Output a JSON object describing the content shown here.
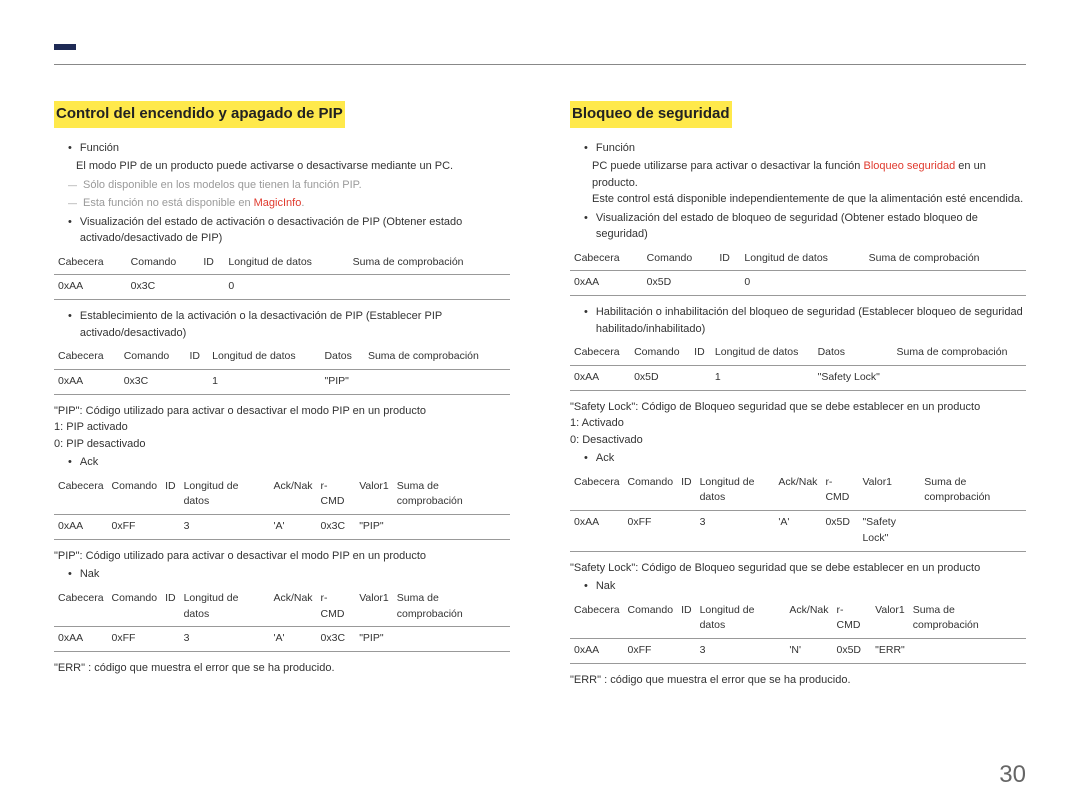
{
  "page_number": "30",
  "left": {
    "title": "Control del encendido y apagado de PIP",
    "b_funcion": "Función",
    "b_funcion_text": "El modo PIP de un producto puede activarse o desactivarse mediante un PC.",
    "note1": "Sólo disponible en los modelos que tienen la función PIP.",
    "note2_a": "Esta función no está disponible en ",
    "note2_b": "MagicInfo",
    "note2_c": ".",
    "b_visualizacion": "Visualización del estado de activación o desactivación de PIP (Obtener estado activado/desactivado de PIP)",
    "t1": {
      "h": [
        "Cabecera",
        "Comando",
        "ID",
        "Longitud de datos",
        "Suma de comprobación"
      ],
      "r": [
        "0xAA",
        "0x3C",
        "",
        "0",
        ""
      ]
    },
    "b_establecimiento": "Establecimiento de la activación o la desactivación de PIP (Establecer PIP activado/desactivado)",
    "t2": {
      "h": [
        "Cabecera",
        "Comando",
        "ID",
        "Longitud de datos",
        "Datos",
        "Suma de comprobación"
      ],
      "r": [
        "0xAA",
        "0x3C",
        "",
        "1",
        "\"PIP\"",
        ""
      ]
    },
    "def_pip": "\"PIP\": Código utilizado para activar o desactivar el modo PIP en un producto",
    "def_1": "1: PIP activado",
    "def_0": "0: PIP desactivado",
    "b_ack": "Ack",
    "t3": {
      "h": [
        "Cabecera",
        "Comando",
        "ID",
        "Longitud de datos",
        "Ack/Nak",
        "r-CMD",
        "Valor1",
        "Suma de comprobación"
      ],
      "r": [
        "0xAA",
        "0xFF",
        "",
        "3",
        "'A'",
        "0x3C",
        "\"PIP\"",
        ""
      ]
    },
    "def_pip2": "\"PIP\": Código utilizado para activar o desactivar el modo PIP en un producto",
    "b_nak": "Nak",
    "t4": {
      "h": [
        "Cabecera",
        "Comando",
        "ID",
        "Longitud de datos",
        "Ack/Nak",
        "r-CMD",
        "Valor1",
        "Suma de comprobación"
      ],
      "r": [
        "0xAA",
        "0xFF",
        "",
        "3",
        "'A'",
        "0x3C",
        "\"PIP\"",
        ""
      ]
    },
    "err_note": "\"ERR\" : código que muestra el error que se ha producido."
  },
  "right": {
    "title": "Bloqueo de seguridad",
    "b_funcion": "Función",
    "b_funcion_text_a": "PC puede utilizarse para activar o desactivar la función ",
    "b_funcion_text_b": "Bloqueo seguridad",
    "b_funcion_text_c": " en un producto.",
    "b_funcion_text2": "Este control está disponible independientemente de que la alimentación esté encendida.",
    "b_visualizacion": "Visualización del estado de bloqueo de seguridad (Obtener estado bloqueo de seguridad)",
    "t1": {
      "h": [
        "Cabecera",
        "Comando",
        "ID",
        "Longitud de datos",
        "Suma de comprobación"
      ],
      "r": [
        "0xAA",
        "0x5D",
        "",
        "0",
        ""
      ]
    },
    "b_hab": "Habilitación o inhabilitación del bloqueo de seguridad (Establecer bloqueo de seguridad habilitado/inhabilitado)",
    "t2": {
      "h": [
        "Cabecera",
        "Comando",
        "ID",
        "Longitud de datos",
        "Datos",
        "Suma de comprobación"
      ],
      "r": [
        "0xAA",
        "0x5D",
        "",
        "1",
        "\"Safety Lock\"",
        ""
      ]
    },
    "def_sl": "\"Safety Lock\": Código de Bloqueo seguridad que se debe establecer en un producto",
    "def_1": "1: Activado",
    "def_0": "0: Desactivado",
    "b_ack": "Ack",
    "t3": {
      "h": [
        "Cabecera",
        "Comando",
        "ID",
        "Longitud de datos",
        "Ack/Nak",
        "r-CMD",
        "Valor1",
        "Suma de comprobación"
      ],
      "r": [
        "0xAA",
        "0xFF",
        "",
        "3",
        "'A'",
        "0x5D",
        "\"Safety Lock\"",
        ""
      ]
    },
    "def_sl2": "\"Safety Lock\": Código de Bloqueo seguridad que se debe establecer en un producto",
    "b_nak": "Nak",
    "t4": {
      "h": [
        "Cabecera",
        "Comando",
        "ID",
        "Longitud de datos",
        "Ack/Nak",
        "r-CMD",
        "Valor1",
        "Suma de comprobación"
      ],
      "r": [
        "0xAA",
        "0xFF",
        "",
        "3",
        "'N'",
        "0x5D",
        "\"ERR\"",
        ""
      ]
    },
    "err_note": "\"ERR\" : código que muestra el error que se ha producido."
  }
}
